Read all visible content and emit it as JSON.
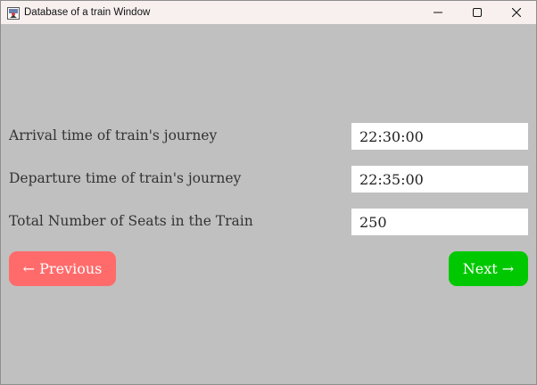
{
  "window": {
    "title": "Database of a train Window"
  },
  "fields": [
    {
      "label": "Arrival time of train's journey",
      "value": "22:30:00"
    },
    {
      "label": "Departure time of train's journey",
      "value": "22:35:00"
    },
    {
      "label": "Total Number of Seats in the Train",
      "value": "250"
    }
  ],
  "buttons": {
    "previous_label": "← Previous",
    "next_label": "Next →"
  },
  "colors": {
    "background": "#c0c0c0",
    "previous_button": "#ff6b6b",
    "next_button": "#00c800",
    "titlebar": "#f7f0ef"
  },
  "icons": {
    "app": "java-app-icon",
    "minimize": "minimize-icon",
    "maximize": "maximize-icon",
    "close": "close-icon"
  }
}
